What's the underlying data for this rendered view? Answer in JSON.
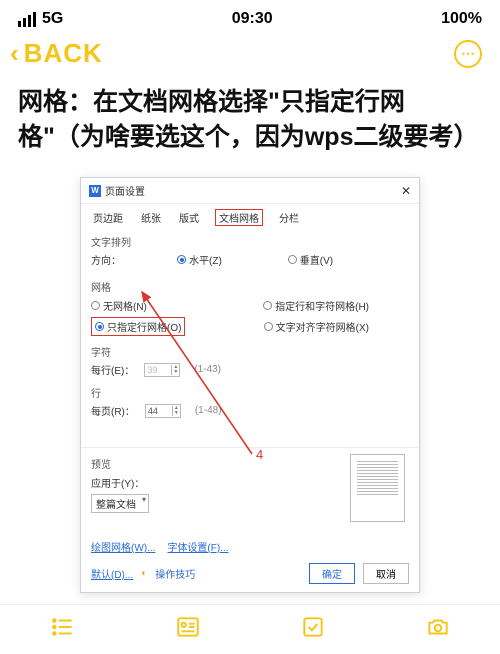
{
  "status": {
    "network": "5G",
    "time": "09:30",
    "battery": "100%"
  },
  "header": {
    "back_label": "BACK"
  },
  "heading": "网格：在文档网格选择\"只指定行网格\"（为啥要选这个，因为wps二级要考）",
  "dialog": {
    "title": "页面设置",
    "tabs": [
      "页边距",
      "纸张",
      "版式",
      "文档网格",
      "分栏"
    ],
    "active_tab_index": 3,
    "direction": {
      "label": "文字排列",
      "field": "方向：",
      "options": [
        "水平(Z)",
        "垂直(V)"
      ],
      "selected": 0
    },
    "grid": {
      "label": "网格",
      "options": [
        "无网格(N)",
        "指定行和字符网格(H)",
        "只指定行网格(O)",
        "文字对齐字符网格(X)"
      ],
      "selected": 2
    },
    "chars": {
      "label": "字符",
      "row_label": "每行(E)：",
      "value": "39",
      "range": "(1-43)"
    },
    "lines": {
      "label": "行",
      "row_label": "每页(R)：",
      "value": "44",
      "range": "(1-48)"
    },
    "preview": {
      "label": "预览",
      "apply_label": "应用于(Y)：",
      "apply_value": "整篇文档"
    },
    "links": [
      "绘图网格(W)...",
      "字体设置(F)..."
    ],
    "footer": {
      "default": "默认(D)...",
      "tips": "操作技巧",
      "ok": "确定",
      "cancel": "取消"
    }
  },
  "annotation": {
    "number": "4"
  }
}
